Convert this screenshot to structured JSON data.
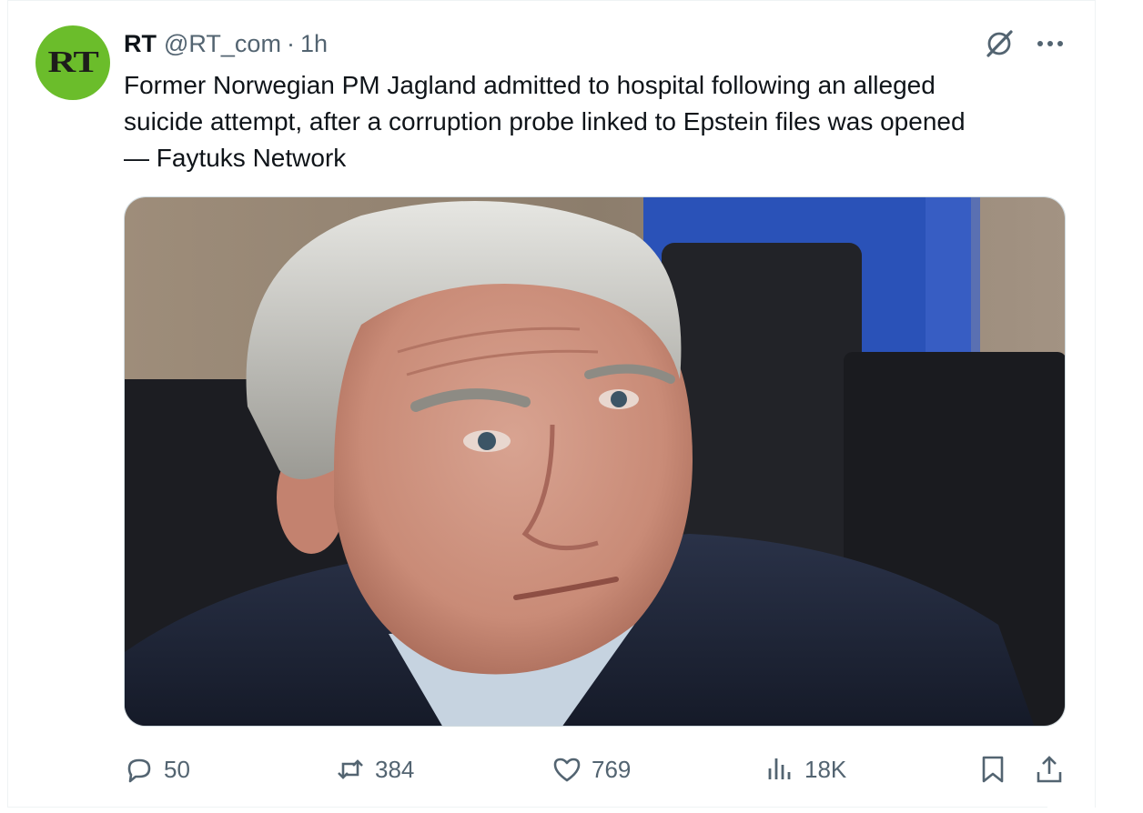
{
  "author": {
    "avatar_text": "RT",
    "name": "RT",
    "handle": "@RT_com",
    "separator": "·",
    "time": "1h"
  },
  "tweet": {
    "text": "Former Norwegian PM Jagland admitted to hospital following an alleged\nsuicide attempt, after a corruption probe linked to Epstein files was opened\n— Faytuks Network"
  },
  "media": {
    "description_icon": "photo-portrait"
  },
  "actions": {
    "replies": "50",
    "reposts": "384",
    "likes": "769",
    "views": "18K"
  },
  "colors": {
    "avatar_bg": "#6bbd2b",
    "text_primary": "#0f1419",
    "text_secondary": "#536471",
    "border": "#cfd9de"
  }
}
